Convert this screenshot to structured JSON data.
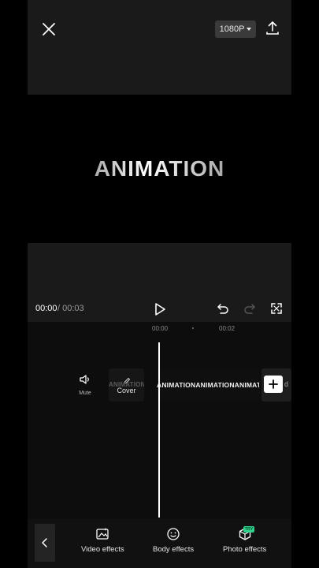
{
  "header": {
    "resolution": "1080P"
  },
  "preview": {
    "overlay_text": "ANIMATION"
  },
  "playback": {
    "current_time": "00:00",
    "total_time": "/ 00:03"
  },
  "timeline": {
    "ruler_marks": [
      "00:00",
      "00:02"
    ],
    "mute_label": "Mute",
    "cover_bg_text": "ANIMATION",
    "cover_label": "Cover",
    "clip_text": "ANIMATIONANIMATIONANIMATION",
    "add_clip_tail": "d"
  },
  "toolbar": {
    "items": [
      {
        "label": "Video effects",
        "icon": "video-effects-icon"
      },
      {
        "label": "Body effects",
        "icon": "body-effects-icon"
      },
      {
        "label": "Photo effects",
        "icon": "photo-effects-icon",
        "badge": "TRY"
      }
    ]
  },
  "colors": {
    "accent_badge": "#2fd08c",
    "background": "#000000",
    "panel": "#1a1a1a"
  }
}
